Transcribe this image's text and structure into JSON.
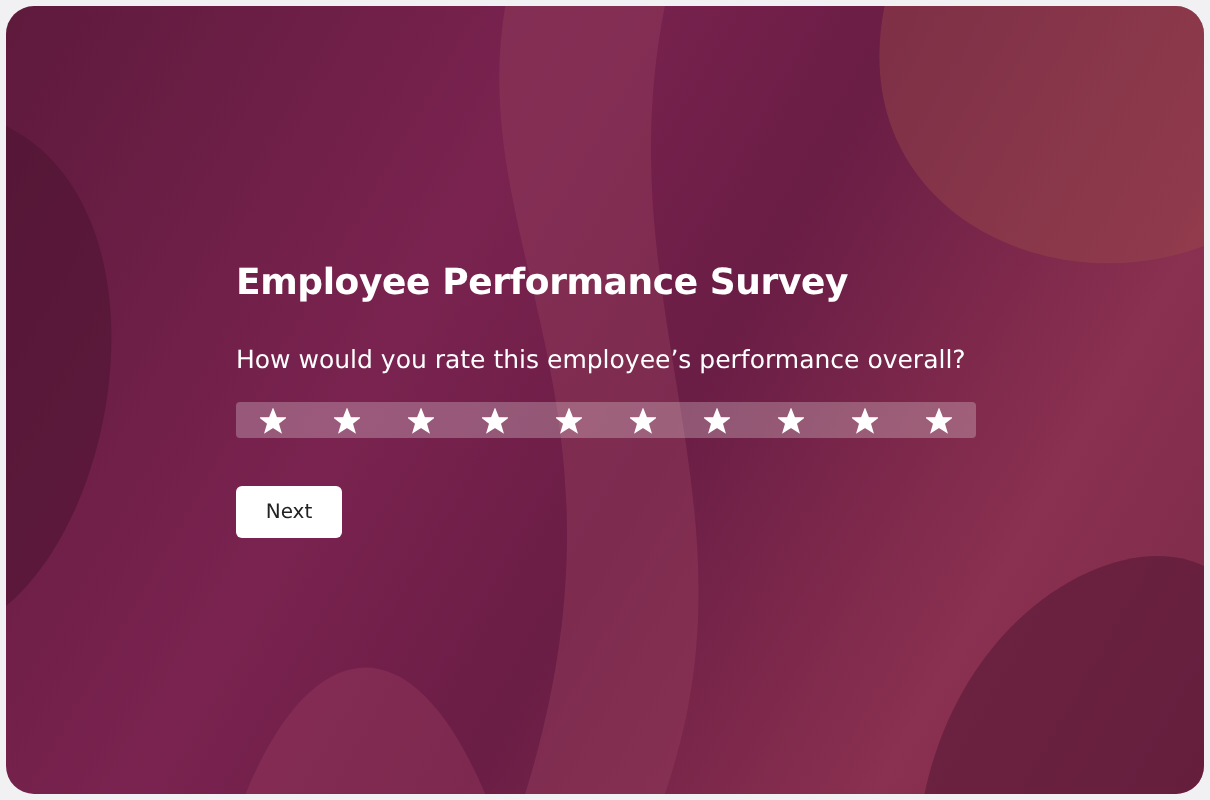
{
  "survey": {
    "title": "Employee Performance Survey",
    "question": "How would you rate this employee’s performance overall?",
    "rating": {
      "stars": 10
    },
    "button": "Next"
  }
}
